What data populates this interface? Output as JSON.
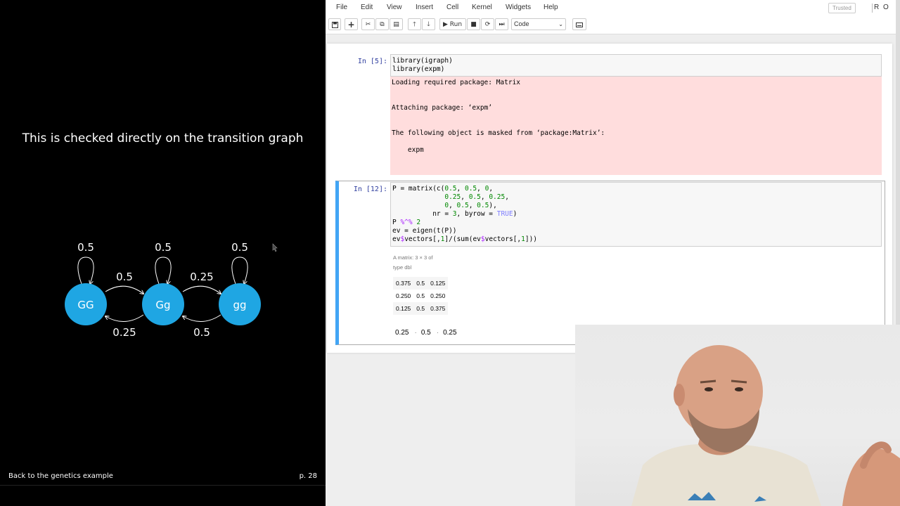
{
  "slide": {
    "title": "This is checked directly on the transition graph",
    "footer_left": "Back to the genetics example",
    "footer_right": "p. 28",
    "nodes": [
      {
        "id": "GG",
        "label": "GG"
      },
      {
        "id": "Gg",
        "label": "Gg"
      },
      {
        "id": "gg",
        "label": "gg"
      }
    ],
    "edges": [
      {
        "from": "GG",
        "to": "GG",
        "label": "0.5"
      },
      {
        "from": "Gg",
        "to": "Gg",
        "label": "0.5"
      },
      {
        "from": "gg",
        "to": "gg",
        "label": "0.5"
      },
      {
        "from": "GG",
        "to": "Gg",
        "label": "0.5"
      },
      {
        "from": "Gg",
        "to": "gg",
        "label": "0.25"
      },
      {
        "from": "Gg",
        "to": "GG",
        "label": "0.25"
      },
      {
        "from": "gg",
        "to": "Gg",
        "label": "0.5"
      }
    ],
    "node_color": "#1fa6e3"
  },
  "notebook": {
    "menu": [
      "File",
      "Edit",
      "View",
      "Insert",
      "Cell",
      "Kernel",
      "Widgets",
      "Help"
    ],
    "trusted_label": "Trusted",
    "kernel_name": "R",
    "kernel_status": "O",
    "toolbar": {
      "run_label": "Run",
      "cell_type": "Code"
    },
    "cells": [
      {
        "prompt": "In [5]:",
        "code_lines": [
          "library(igraph)",
          "library(expm)"
        ],
        "stderr_lines": [
          "Loading required package: Matrix",
          "",
          "",
          "Attaching package: ‘expm’",
          "",
          "",
          "The following object is masked from ‘package:Matrix’:",
          "",
          "    expm",
          ""
        ]
      },
      {
        "prompt": "In [12]:",
        "matrix_caption_1": "A matrix: 3 × 3 of",
        "matrix_caption_2": "type dbl",
        "matrix_rows": [
          [
            "0.375",
            "0.5",
            "0.125"
          ],
          [
            "0.250",
            "0.5",
            "0.250"
          ],
          [
            "0.125",
            "0.5",
            "0.375"
          ]
        ],
        "vector_output": [
          "0.25",
          "0.5",
          "0.25"
        ]
      }
    ]
  },
  "colors": {
    "selected_cell_border": "#42a5f5",
    "stderr_background": "#ffdddd",
    "prompt_color": "#303f9f"
  }
}
